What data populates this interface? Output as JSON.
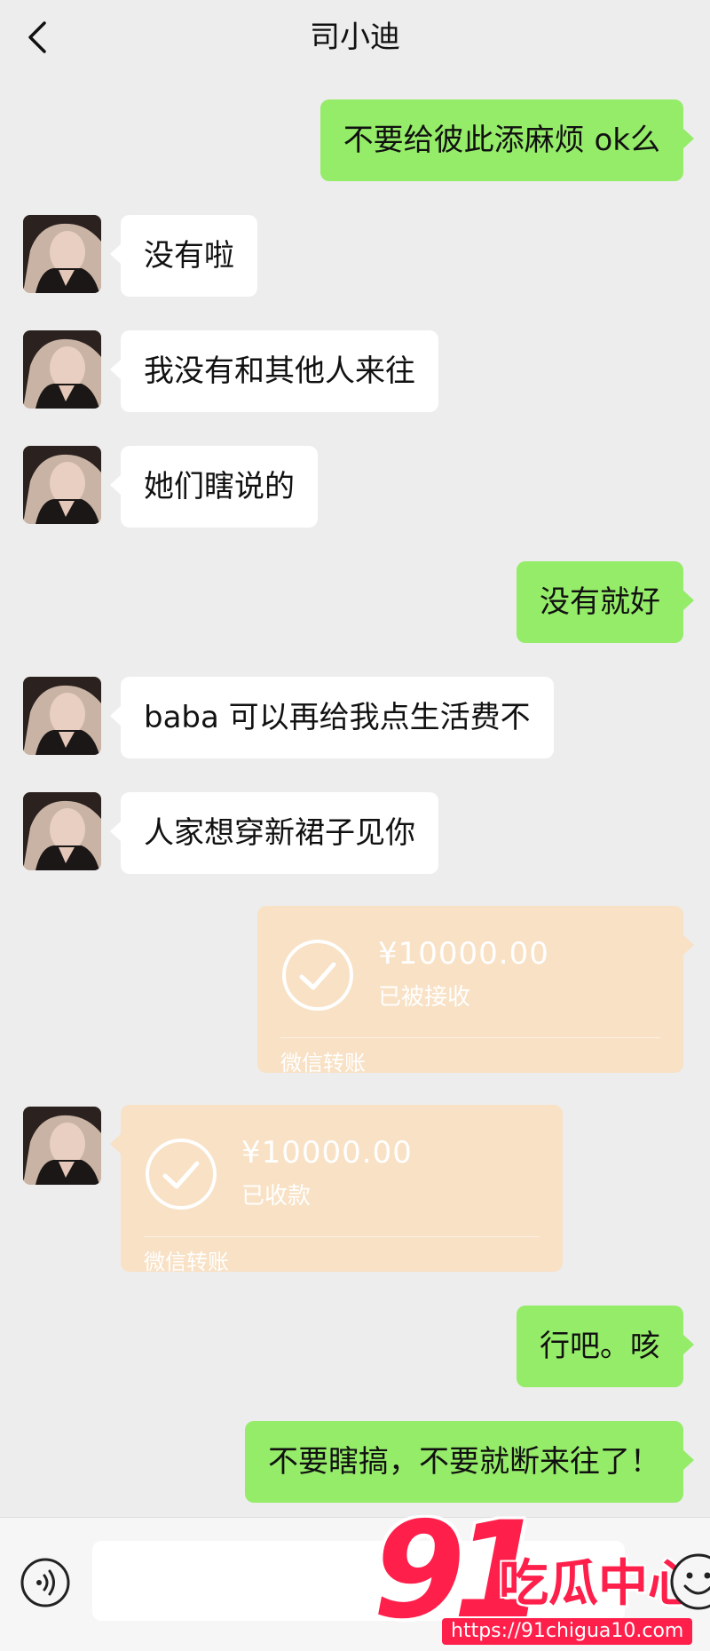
{
  "header": {
    "title": "司小迪",
    "back_icon": "chevron-left-icon"
  },
  "messages": [
    {
      "side": "out",
      "text": "不要给彼此添麻烦 ok么"
    },
    {
      "side": "in",
      "text": "没有啦"
    },
    {
      "side": "in",
      "text": "我没有和其他人来往"
    },
    {
      "side": "in",
      "text": "她们瞎说的"
    },
    {
      "side": "out",
      "text": "没有就好"
    },
    {
      "side": "in",
      "text": "baba 可以再给我点生活费不"
    },
    {
      "side": "in",
      "text": "人家想穿新裙子见你"
    },
    {
      "side": "out",
      "type": "transfer",
      "amount": "¥10000.00",
      "status": "已被接收",
      "label": "微信转账"
    },
    {
      "side": "in",
      "type": "transfer",
      "amount": "¥10000.00",
      "status": "已收款",
      "label": "微信转账"
    },
    {
      "side": "out",
      "text": "行吧。咳"
    },
    {
      "side": "out",
      "text": "不要瞎搞，不要就断来往了！"
    }
  ],
  "input_bar": {
    "voice_icon": "voice-icon",
    "input_value": "",
    "emoji_icon": "emoji-icon"
  },
  "watermark": {
    "number": "91",
    "brand": "吃瓜中心",
    "url": "https://91chigua10.com"
  },
  "colors": {
    "background": "#ededed",
    "outgoing": "#95ec69",
    "incoming": "#ffffff",
    "transfer": "#f8e1c5",
    "watermark": "#ff1f4b"
  }
}
